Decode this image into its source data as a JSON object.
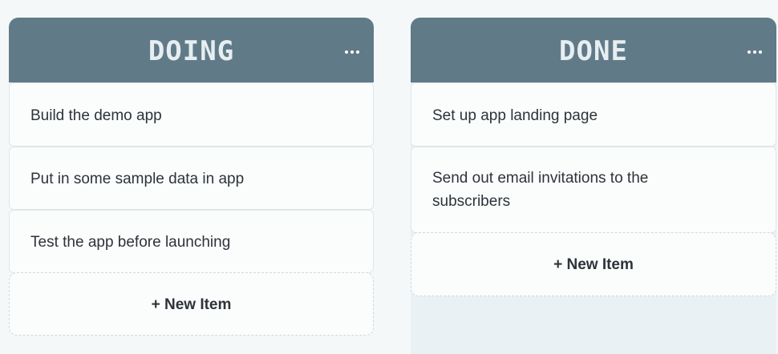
{
  "board": {
    "columns": [
      {
        "title": "DOING",
        "menu_icon": "more-horizontal-icon",
        "cards": [
          "Build the demo app",
          "Put in some sample data in app",
          "Test the app before launching"
        ],
        "new_item_label": "+ New Item"
      },
      {
        "title": "DONE",
        "menu_icon": "more-horizontal-icon",
        "cards": [
          "Set up app landing page",
          "Send out email invitations to the subscribers"
        ],
        "new_item_label": "+ New Item"
      }
    ]
  },
  "colors": {
    "header": "#617a87",
    "header_text": "#e6eef2",
    "card_bg": "#fbfdfd",
    "page_bg": "#f4f8f9"
  }
}
